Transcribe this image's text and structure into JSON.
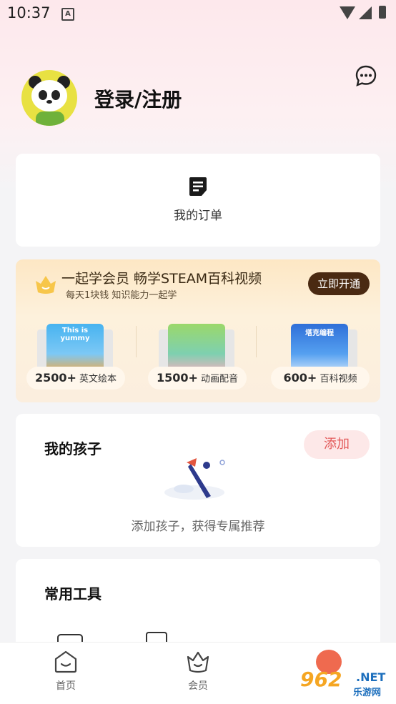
{
  "status_bar": {
    "time": "10:37",
    "notif_letter": "A"
  },
  "header": {
    "login_label": "登录/注册"
  },
  "orders": {
    "label": "我的订单"
  },
  "vip": {
    "title": "一起学会员 畅学STEAM百科视频",
    "subtitle": "每天1块钱 知识能力一起学",
    "open_label": "立即开通",
    "features": [
      {
        "count": "2500+",
        "label": "英文绘本",
        "cover_text": "This is yummy"
      },
      {
        "count": "1500+",
        "label": "动画配音",
        "cover_text": ""
      },
      {
        "count": "600+",
        "label": "百科视频",
        "cover_text": "塔克编程"
      }
    ]
  },
  "kids": {
    "title": "我的孩子",
    "add_label": "添加",
    "hint": "添加孩子，获得专属推荐"
  },
  "tools": {
    "title": "常用工具"
  },
  "tabbar": {
    "tabs": [
      {
        "label": "首页"
      },
      {
        "label": "会员"
      }
    ]
  },
  "watermark": {
    "brand": "962",
    "suffix": ".NET",
    "sub": "乐游网"
  },
  "colors": {
    "accent_red": "#e35a5a",
    "vip_button": "#4a2a12",
    "header_pink": "#fde8ec"
  }
}
